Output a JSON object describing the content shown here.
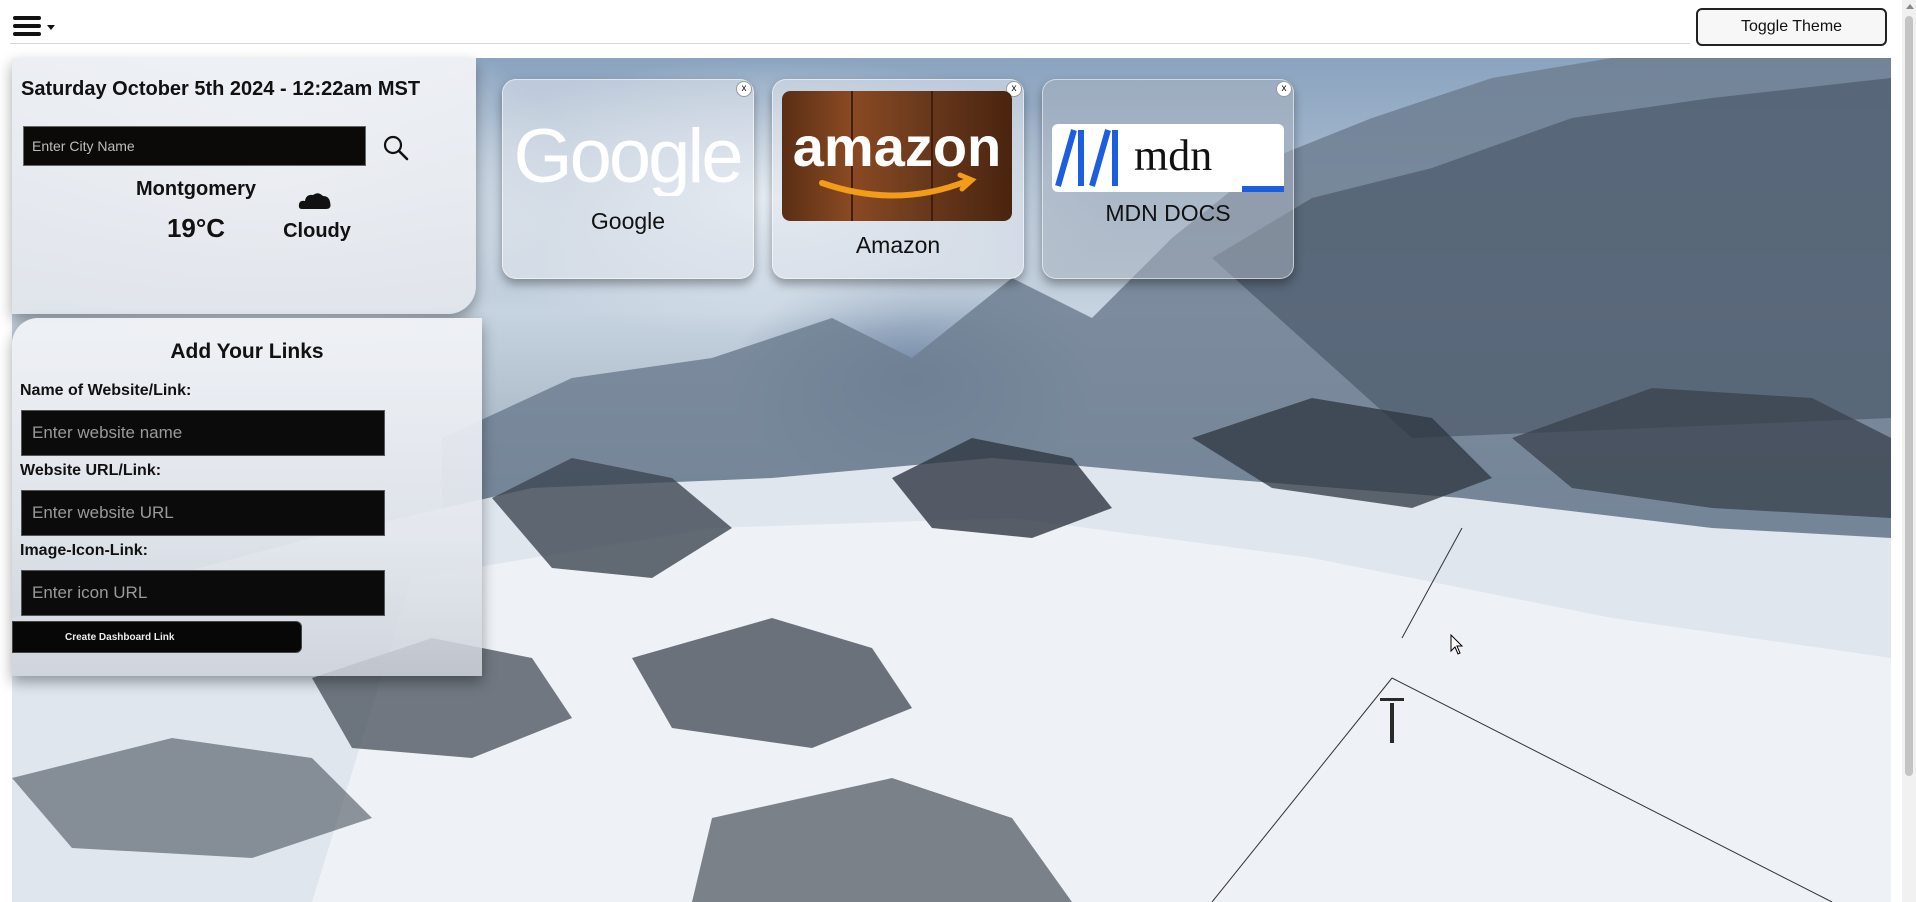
{
  "header": {
    "menu_icon": "hamburger-menu-icon",
    "toggle_theme_label": "Toggle Theme"
  },
  "weather": {
    "datetime": "Saturday October 5th 2024 - 12:22am MST",
    "city_placeholder": "Enter City Name",
    "search_icon": "search-icon",
    "city": "Montgomery",
    "temperature": "19°C",
    "condition_icon": "cloud-icon",
    "condition": "Cloudy"
  },
  "add_links": {
    "title": "Add Your Links",
    "name_label": "Name of Website/Link:",
    "name_placeholder": "Enter website name",
    "url_label": "Website URL/Link:",
    "url_placeholder": "Enter website URL",
    "icon_label": "Image-Icon-Link:",
    "icon_placeholder": "Enter icon URL",
    "create_button": "Create Dashboard Link"
  },
  "links": [
    {
      "label": "Google",
      "logo_text": "Google",
      "close": "x"
    },
    {
      "label": "Amazon",
      "logo_text": "amazon",
      "close": "x"
    },
    {
      "label": "MDN DOCS",
      "logo_text": "mdn",
      "close": "x"
    }
  ],
  "colors": {
    "panel_bg": "#e8ebf0",
    "input_bg": "#0b0a09",
    "amazon_bg": "#6b3a1d",
    "amazon_smile": "#f39c1a",
    "mdn_blue": "#1b5fe0"
  }
}
